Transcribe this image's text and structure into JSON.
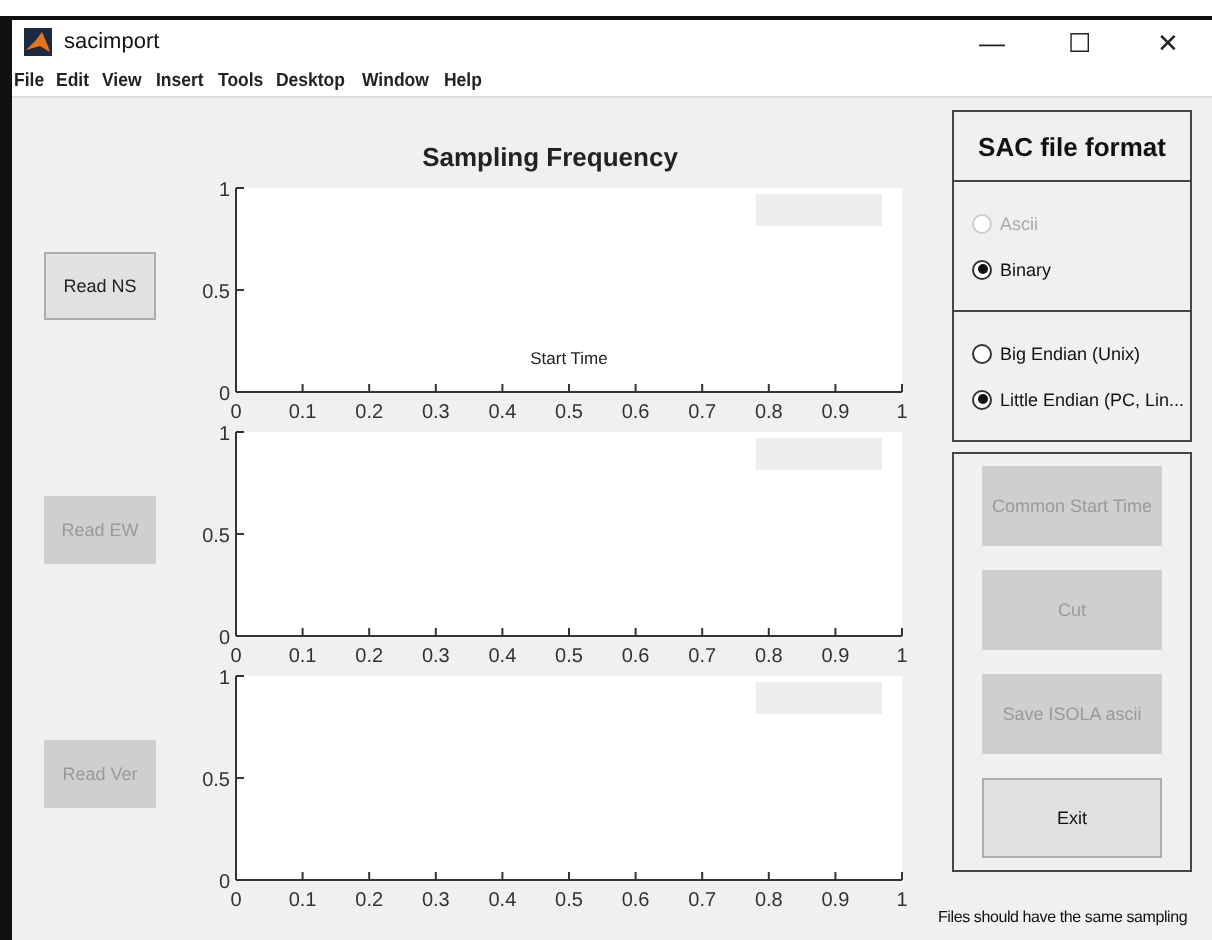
{
  "window": {
    "title": "sacimport",
    "controls": [
      "—",
      "☐",
      "✕"
    ]
  },
  "menu": [
    "File",
    "Edit",
    "View",
    "Insert",
    "Tools",
    "Desktop",
    "Window",
    "Help"
  ],
  "figure_title": "Sampling Frequency",
  "plots": [
    {
      "read_button": {
        "label": "Read NS",
        "disabled": false
      },
      "chart_data": {
        "type": "line",
        "xlabel": "Start Time",
        "xlim": [
          0,
          1
        ],
        "ylim": [
          0,
          1
        ],
        "xticks": [
          0,
          0.1,
          0.2,
          0.3,
          0.4,
          0.5,
          0.6,
          0.7,
          0.8,
          0.9,
          1
        ],
        "yticks": [
          0,
          0.5,
          1
        ]
      }
    },
    {
      "read_button": {
        "label": "Read EW",
        "disabled": true
      },
      "chart_data": {
        "type": "line",
        "xlim": [
          0,
          1
        ],
        "ylim": [
          0,
          1
        ],
        "xticks": [
          0,
          0.1,
          0.2,
          0.3,
          0.4,
          0.5,
          0.6,
          0.7,
          0.8,
          0.9,
          1
        ],
        "yticks": [
          0,
          0.5,
          1
        ]
      }
    },
    {
      "read_button": {
        "label": "Read Ver",
        "disabled": true
      },
      "chart_data": {
        "type": "line",
        "xlim": [
          0,
          1
        ],
        "ylim": [
          0,
          1
        ],
        "xticks": [
          0,
          0.1,
          0.2,
          0.3,
          0.4,
          0.5,
          0.6,
          0.7,
          0.8,
          0.9,
          1
        ],
        "yticks": [
          0,
          0.5,
          1
        ]
      }
    }
  ],
  "sac_panel": {
    "title": "SAC file format",
    "format_options": [
      {
        "label": "Ascii",
        "selected": false,
        "disabled": true
      },
      {
        "label": "Binary",
        "selected": true,
        "disabled": false
      }
    ],
    "endian_options": [
      {
        "label": "Big Endian  (Unix)",
        "selected": false,
        "disabled": false
      },
      {
        "label": "Little Endian (PC, Lin...",
        "selected": true,
        "disabled": false
      }
    ],
    "actions": [
      {
        "label": "Common Start Time",
        "disabled": true
      },
      {
        "label": "Cut",
        "disabled": true
      },
      {
        "label": "Save ISOLA ascii",
        "disabled": true
      },
      {
        "label": "Exit",
        "disabled": false
      }
    ],
    "note": "Files should have the same sampling"
  }
}
